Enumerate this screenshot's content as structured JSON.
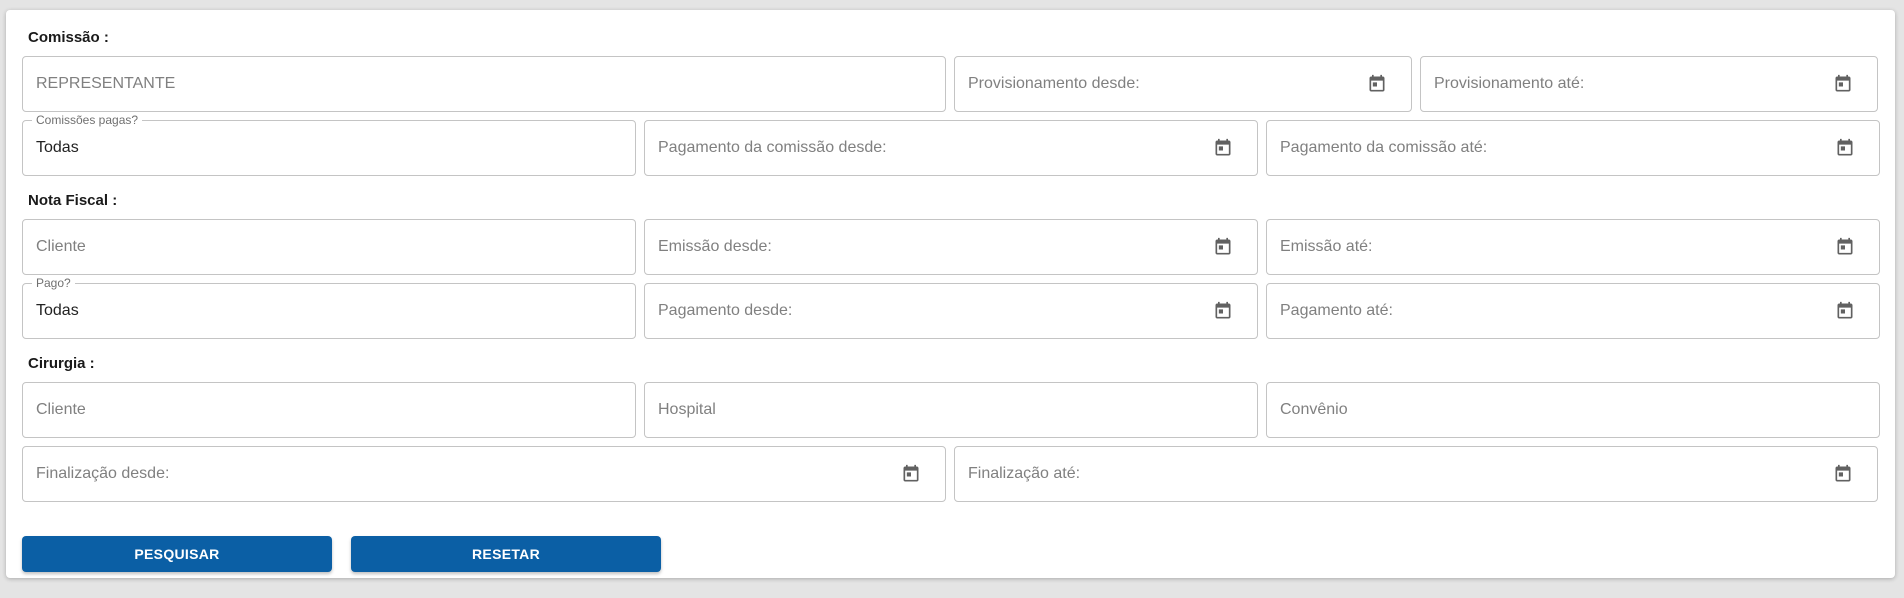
{
  "sections": {
    "comissao": "Comissão :",
    "nota_fiscal": "Nota Fiscal :",
    "cirurgia": "Cirurgia :"
  },
  "comissao": {
    "representante_placeholder": "REPRESENTANTE",
    "provisionamento_desde": "Provisionamento desde:",
    "provisionamento_ate": "Provisionamento até:",
    "comissoes_pagas_label": "Comissões pagas?",
    "comissoes_pagas_value": "Todas",
    "pagamento_comissao_desde": "Pagamento da comissão desde:",
    "pagamento_comissao_ate": "Pagamento da comissão até:"
  },
  "nota_fiscal": {
    "cliente_placeholder": "Cliente",
    "emissao_desde": "Emissão desde:",
    "emissao_ate": "Emissão até:",
    "pago_label": "Pago?",
    "pago_value": "Todas",
    "pagamento_desde": "Pagamento desde:",
    "pagamento_ate": "Pagamento até:"
  },
  "cirurgia": {
    "cliente_placeholder": "Cliente",
    "hospital_placeholder": "Hospital",
    "convenio_placeholder": "Convênio",
    "finalizacao_desde": "Finalização desde:",
    "finalizacao_ate": "Finalização até:"
  },
  "buttons": {
    "pesquisar": "PESQUISAR",
    "resetar": "RESETAR"
  },
  "colors": {
    "primary": "#0b5fa5",
    "border": "#c4c4c4",
    "icon": "#616161"
  },
  "icons": {
    "date_picker": "calendar-icon"
  }
}
